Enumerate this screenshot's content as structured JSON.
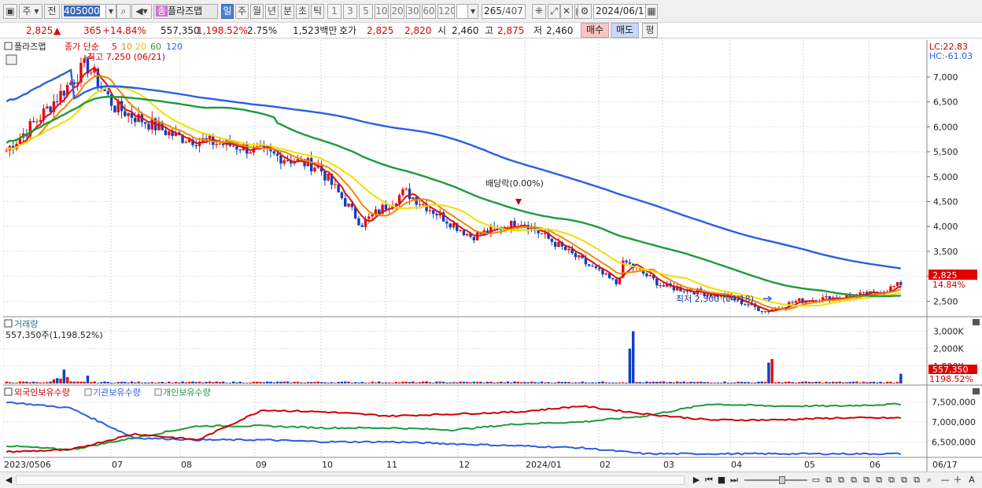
{
  "toolbar": {
    "market": "주",
    "prev": "전",
    "code": "405000",
    "badge": "종",
    "name": "플라즈맵",
    "periods": [
      "일",
      "주",
      "월",
      "년",
      "분",
      "초",
      "틱"
    ],
    "minutes": [
      "1",
      "3",
      "5",
      "10",
      "20",
      "30",
      "60",
      "120"
    ],
    "count_value": "265",
    "count_total": "/407",
    "date": "2024/06/17"
  },
  "infobar": {
    "price": "2,825",
    "arrow": "▲",
    "change": "365",
    "change_pct": "+14.84%",
    "volume": "557,350",
    "volume_pct": "1,198.52%",
    "turnover": "2.75%",
    "amount": "1,523백만",
    "hoga_label": "호가",
    "ask": "2,825",
    "bid": "2,820",
    "open_label": "시",
    "open": "2,460",
    "high_label": "고",
    "high": "2,875",
    "low_label": "저",
    "low": "2,460",
    "buy_btn": "매수",
    "sell_btn": "매도",
    "avg_btn": "평"
  },
  "price_panel": {
    "title": "플라즈맵",
    "ma_label": "종가 단순",
    "ma_periods": [
      "5",
      "10",
      "20",
      "60",
      "120"
    ],
    "ma_colors": [
      "#dd1111",
      "#f08a00",
      "#f0e000",
      "#1e9a3c",
      "#2b5fe0"
    ],
    "lc": "LC:22.83",
    "hc": "HC:-61.03",
    "y_ticks": [
      "7,000",
      "6,500",
      "6,000",
      "5,500",
      "5,000",
      "4,500",
      "4,000",
      "3,500",
      "3,000",
      "2,500"
    ],
    "high_annot": "최고 7,250 (06/21)",
    "low_annot": "최저 2,300 (04/18)",
    "div_annot": "배당락(0.00%)",
    "last_price": "2,825",
    "last_pct": "14.84%"
  },
  "volume_panel": {
    "title": "거래량",
    "info": "557,350주(1,198.52%)",
    "y_ticks": [
      "3,000K",
      "2,000K",
      "1,000K"
    ],
    "last_vol": "557,350",
    "last_pct": "1198.52%"
  },
  "holdings_panel": {
    "titles": [
      "외국인보유수량",
      "기관보유수량",
      "개인보유수량"
    ],
    "colors": [
      "#cc0000",
      "#2b5fe0",
      "#1e9a3c"
    ],
    "y_ticks": [
      "7,500,000",
      "7,000,000",
      "6,500,000"
    ]
  },
  "x_axis": [
    "2023/0506",
    "07",
    "08",
    "09",
    "10",
    "11",
    "12",
    "2024/01",
    "02",
    "03",
    "04",
    "05",
    "06"
  ],
  "x_end": "06/17",
  "chart_data": {
    "type": "line",
    "price_ylim": [
      2300,
      7300
    ],
    "volume_ylim": [
      0,
      3200
    ],
    "holdings_ylim": [
      6150000,
      7650000
    ],
    "close_series": {
      "x": [
        "2023/05",
        "2023/06",
        "2023/06/21",
        "2023/07",
        "2023/08",
        "2023/09",
        "2023/10",
        "2023/11",
        "2023/11 mid",
        "2023/12",
        "2024/01",
        "2024/02",
        "2024/02 end",
        "2024/03",
        "2024/04",
        "2024/04/18",
        "2024/05",
        "2024/06",
        "2024/06/17"
      ],
      "values": [
        5500,
        6200,
        7250,
        6400,
        5800,
        5600,
        5200,
        4050,
        4700,
        3800,
        4100,
        2850,
        3300,
        2800,
        2600,
        2300,
        2500,
        2650,
        2825
      ]
    },
    "volume_k_peaks": [
      {
        "x": "2024/02",
        "value": 3000
      },
      {
        "x": "2024/04",
        "value": 1400
      },
      {
        "x": "2024/06/17",
        "value": 557.35
      }
    ],
    "foreign_holdings": [
      6250000,
      6300000,
      6700000,
      6550000,
      7300000,
      7250000,
      7150000,
      7200000,
      7250000,
      7400000,
      7200000,
      7050000,
      7050000,
      7100000,
      7100000
    ],
    "institution_holdings": [
      7500000,
      7350000,
      6600000,
      6550000,
      6550000,
      6500000,
      6500000,
      6450000,
      6400000,
      6350000,
      6200000,
      6200000,
      6200000,
      6200000,
      6200000
    ],
    "individual_holdings": [
      6400000,
      6300000,
      6600000,
      6900000,
      6900000,
      6850000,
      6850000,
      6800000,
      6950000,
      7000000,
      7150000,
      7450000,
      7400000,
      7400000,
      7450000
    ]
  },
  "statusbar": {
    "nav": [
      "▶",
      "⏮",
      "■",
      "⏭"
    ],
    "zoom": [
      "—",
      "＋",
      "A"
    ]
  }
}
